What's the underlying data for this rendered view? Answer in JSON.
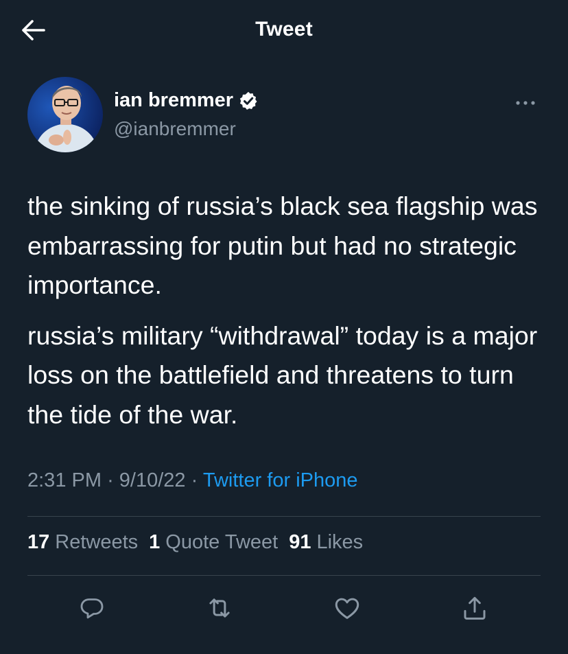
{
  "header": {
    "back_icon": "arrow-left-icon",
    "title": "Tweet"
  },
  "author": {
    "display_name": "ian bremmer",
    "handle": "@ianbremmer",
    "verified": true,
    "verified_icon": "verified-badge-icon",
    "more_icon": "more-horizontal-icon"
  },
  "tweet": {
    "paragraphs": [
      "the sinking of russia’s black sea flagship was embarrassing for putin but had no strategic importance.",
      "russia’s military “withdrawal” today is a major loss on the battlefield and threatens to turn the tide of the war."
    ],
    "time": "2:31 PM",
    "separator": "·",
    "date": "9/10/22",
    "source": "Twitter for iPhone"
  },
  "stats": {
    "retweets": {
      "count": "17",
      "label": "Retweets"
    },
    "quotes": {
      "count": "1",
      "label": "Quote Tweet"
    },
    "likes": {
      "count": "91",
      "label": "Likes"
    }
  },
  "actions": [
    {
      "icon": "reply-icon"
    },
    {
      "icon": "retweet-icon"
    },
    {
      "icon": "like-heart-icon"
    },
    {
      "icon": "share-icon"
    }
  ],
  "colors": {
    "background": "#15202b",
    "text_primary": "#ffffff",
    "text_secondary": "#8b98a5",
    "accent": "#1d9bf0",
    "divider": "#38444d"
  }
}
